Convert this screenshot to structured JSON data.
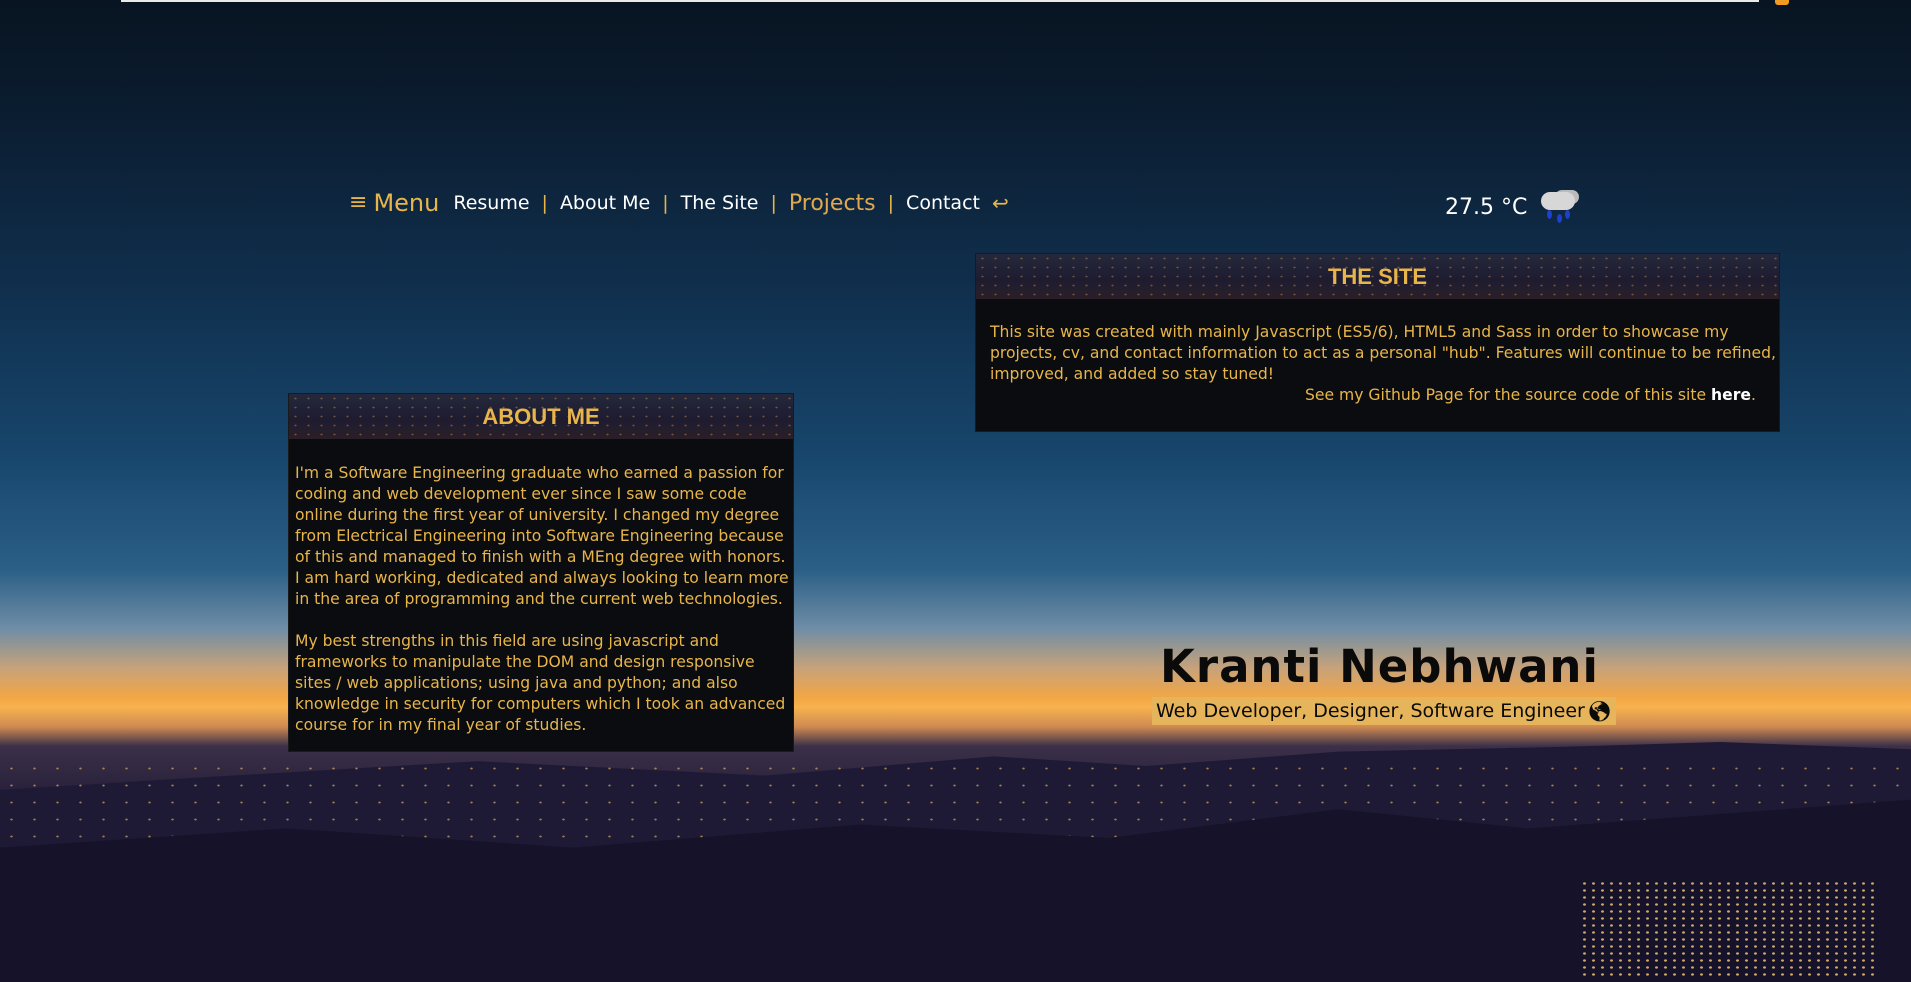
{
  "nav": {
    "menu_icon": "hamburger-icon",
    "menu_label": "Menu",
    "links": [
      {
        "label": "Resume"
      },
      {
        "label": "About Me"
      },
      {
        "label": "The Site"
      },
      {
        "label": "Projects"
      },
      {
        "label": "Contact"
      }
    ],
    "separator": "|",
    "back_icon": "return-arrow-icon",
    "back_glyph": "↩"
  },
  "weather": {
    "temperature": "27.5 °C",
    "icon": "rain-cloud-icon"
  },
  "about": {
    "title": "ABOUT ME",
    "paragraphs": [
      "I'm a Software Engineering graduate who earned a passion for coding and web development ever since I saw some code online during the first year of university. I changed my degree from Electrical Engineering into Software Engineering because of this and managed to finish with a MEng degree with honors. I am hard working, dedicated and always looking to learn more in the area of programming and the current web technologies.",
      "My best strengths in this field are using javascript and frameworks to manipulate the DOM and design responsive sites / web applications; using java and python; and also knowledge in security for computers which I took an advanced course for in my final year of studies."
    ]
  },
  "site": {
    "title": "THE SITE",
    "description": "This site was created with mainly Javascript (ES5/6), HTML5 and Sass in order to showcase my projects, cv, and contact information to act as a personal \"hub\". Features will continue to be refined, improved, and added so stay tuned!",
    "github_text": "See my Github Page for the source code of this site ",
    "github_link": "here",
    "github_tail": "."
  },
  "hero": {
    "name": "Kranti Nebhwani",
    "subtitle": "Web Developer, Designer, Software Engineer",
    "icon": "globe-icon"
  },
  "colors": {
    "accent": "#e8b54a",
    "panel_bg": "#0a0c10",
    "text_dark": "#0a0a0a"
  }
}
